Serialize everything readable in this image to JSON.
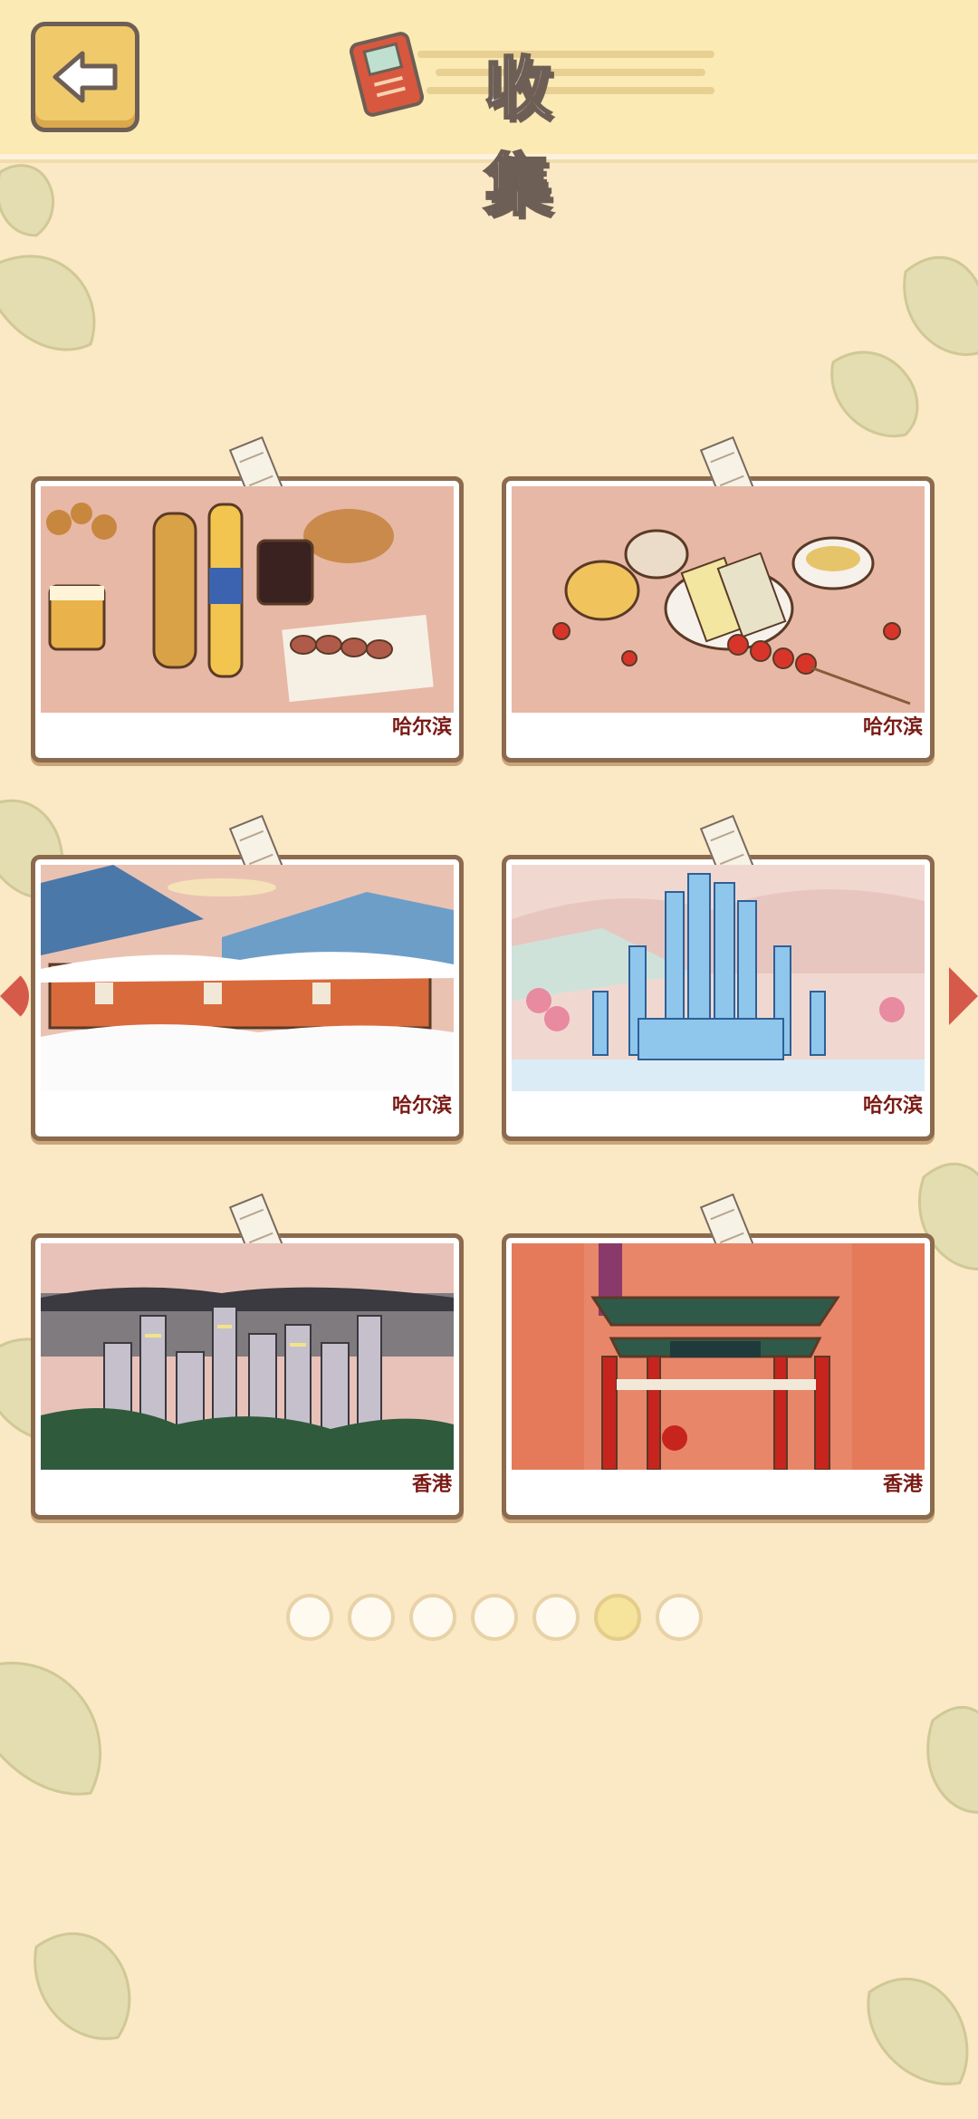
{
  "header": {
    "title": "收 集",
    "back_icon": "arrow-left-icon",
    "title_icon": "album-book-icon"
  },
  "cards": [
    {
      "label": "哈尔滨",
      "scene": "food-beer-sausage"
    },
    {
      "label": "哈尔滨",
      "scene": "ice-cream-tanghulu"
    },
    {
      "label": "哈尔滨",
      "scene": "snow-village"
    },
    {
      "label": "哈尔滨",
      "scene": "ice-castle"
    },
    {
      "label": "香港",
      "scene": "skyline-night"
    },
    {
      "label": "香港",
      "scene": "temple-street-gate"
    }
  ],
  "pagination": {
    "total": 7,
    "current": 6
  },
  "colors": {
    "background": "#fbe8c4",
    "header": "#fbeab4",
    "card_border": "#8c6a4d",
    "label": "#7a1a14",
    "arrow": "#d65a4a"
  }
}
